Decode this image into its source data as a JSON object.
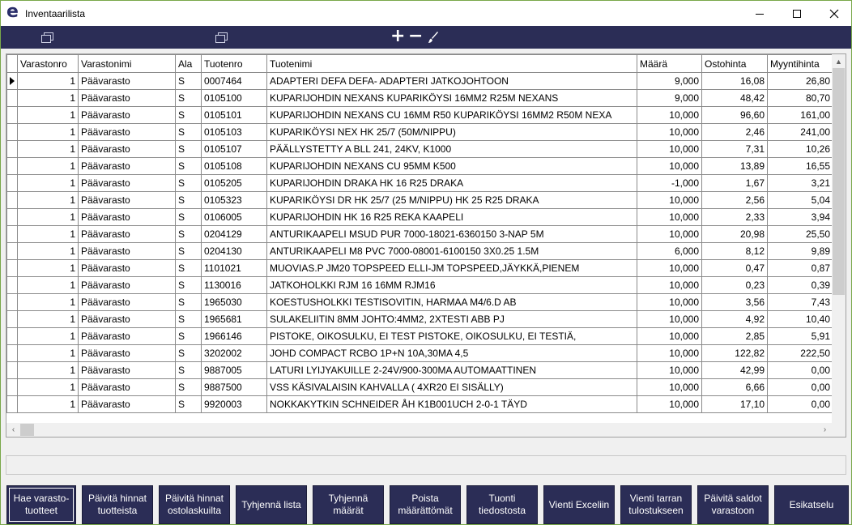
{
  "window": {
    "title": "Inventaarilista",
    "logo": "e"
  },
  "toolbar": {
    "icons": [
      "window-stack-icon",
      "window-stack-icon",
      "plus-icon",
      "minus-icon",
      "brush-icon"
    ],
    "plus": "+",
    "minus": "−"
  },
  "columns": [
    "Varastonro",
    "Varastonimi",
    "Ala",
    "Tuotenro",
    "Tuotenimi",
    "Määrä",
    "Ostohinta",
    "Myyntihinta"
  ],
  "rows": [
    {
      "varastonro": "1",
      "varastonimi": "Päävarasto",
      "ala": "S",
      "tuotenro": "0007464",
      "tuotenimi": "ADAPTERI DEFA DEFA- ADAPTERI JATKOJOHTOON",
      "maara": "9,000",
      "ostohinta": "16,08",
      "myyntihinta": "26,80"
    },
    {
      "varastonro": "1",
      "varastonimi": "Päävarasto",
      "ala": "S",
      "tuotenro": "0105100",
      "tuotenimi": "KUPARIJOHDIN NEXANS KUPARIKÖYSI 16MM2 R25M NEXANS",
      "maara": "9,000",
      "ostohinta": "48,42",
      "myyntihinta": "80,70"
    },
    {
      "varastonro": "1",
      "varastonimi": "Päävarasto",
      "ala": "S",
      "tuotenro": "0105101",
      "tuotenimi": "KUPARIJOHDIN NEXANS CU 16MM R50 KUPARIKÖYSI 16MM2 R50M NEXA",
      "maara": "10,000",
      "ostohinta": "96,60",
      "myyntihinta": "161,00"
    },
    {
      "varastonro": "1",
      "varastonimi": "Päävarasto",
      "ala": "S",
      "tuotenro": "0105103",
      "tuotenimi": "KUPARIKÖYSI NEX HK 25/7 (50M/NIPPU)",
      "maara": "10,000",
      "ostohinta": "2,46",
      "myyntihinta": "241,00"
    },
    {
      "varastonro": "1",
      "varastonimi": "Päävarasto",
      "ala": "S",
      "tuotenro": "0105107",
      "tuotenimi": "PÄÄLLYSTETTY A BLL 241, 24KV, K1000",
      "maara": "10,000",
      "ostohinta": "7,31",
      "myyntihinta": "10,26"
    },
    {
      "varastonro": "1",
      "varastonimi": "Päävarasto",
      "ala": "S",
      "tuotenro": "0105108",
      "tuotenimi": "KUPARIJOHDIN NEXANS CU 95MM K500",
      "maara": "10,000",
      "ostohinta": "13,89",
      "myyntihinta": "16,55"
    },
    {
      "varastonro": "1",
      "varastonimi": "Päävarasto",
      "ala": "S",
      "tuotenro": "0105205",
      "tuotenimi": "KUPARIJOHDIN DRAKA HK 16 R25 DRAKA",
      "maara": "-1,000",
      "ostohinta": "1,67",
      "myyntihinta": "3,21"
    },
    {
      "varastonro": "1",
      "varastonimi": "Päävarasto",
      "ala": "S",
      "tuotenro": "0105323",
      "tuotenimi": "KUPARIKÖYSI DR HK 25/7 (25 M/NIPPU) HK 25 R25 DRAKA",
      "maara": "10,000",
      "ostohinta": "2,56",
      "myyntihinta": "5,04"
    },
    {
      "varastonro": "1",
      "varastonimi": "Päävarasto",
      "ala": "S",
      "tuotenro": "0106005",
      "tuotenimi": "KUPARIJOHDIN HK 16 R25 REKA KAAPELI",
      "maara": "10,000",
      "ostohinta": "2,33",
      "myyntihinta": "3,94"
    },
    {
      "varastonro": "1",
      "varastonimi": "Päävarasto",
      "ala": "S",
      "tuotenro": "0204129",
      "tuotenimi": "ANTURIKAAPELI MSUD PUR 7000-18021-6360150 3-NAP 5M",
      "maara": "10,000",
      "ostohinta": "20,98",
      "myyntihinta": "25,50"
    },
    {
      "varastonro": "1",
      "varastonimi": "Päävarasto",
      "ala": "S",
      "tuotenro": "0204130",
      "tuotenimi": "ANTURIKAAPELI M8 PVC 7000-08001-6100150 3X0.25 1.5M",
      "maara": "6,000",
      "ostohinta": "8,12",
      "myyntihinta": "9,89"
    },
    {
      "varastonro": "1",
      "varastonimi": "Päävarasto",
      "ala": "S",
      "tuotenro": "1101021",
      "tuotenimi": "MUOVIAS.P JM20 TOPSPEED ELLI-JM TOPSPEED,JÄYKKÄ,PIENEM",
      "maara": "10,000",
      "ostohinta": "0,47",
      "myyntihinta": "0,87"
    },
    {
      "varastonro": "1",
      "varastonimi": "Päävarasto",
      "ala": "S",
      "tuotenro": "1130016",
      "tuotenimi": "JATKOHOLKKI RJM 16 16MM RJM16",
      "maara": "10,000",
      "ostohinta": "0,23",
      "myyntihinta": "0,39"
    },
    {
      "varastonro": "1",
      "varastonimi": "Päävarasto",
      "ala": "S",
      "tuotenro": "1965030",
      "tuotenimi": "KOESTUSHOLKKI TESTISOVITIN, HARMAA M4/6.D AB",
      "maara": "10,000",
      "ostohinta": "3,56",
      "myyntihinta": "7,43"
    },
    {
      "varastonro": "1",
      "varastonimi": "Päävarasto",
      "ala": "S",
      "tuotenro": "1965681",
      "tuotenimi": "SULAKELIITIN 8MM JOHTO:4MM2, 2XTESTI ABB PJ",
      "maara": "10,000",
      "ostohinta": "4,92",
      "myyntihinta": "10,40"
    },
    {
      "varastonro": "1",
      "varastonimi": "Päävarasto",
      "ala": "S",
      "tuotenro": "1966146",
      "tuotenimi": "PISTOKE, OIKOSULKU, EI TEST PISTOKE, OIKOSULKU, EI TESTIÄ,",
      "maara": "10,000",
      "ostohinta": "2,85",
      "myyntihinta": "5,91"
    },
    {
      "varastonro": "1",
      "varastonimi": "Päävarasto",
      "ala": "S",
      "tuotenro": "3202002",
      "tuotenimi": "JOHD COMPACT RCBO 1P+N 10A,30MA 4,5",
      "maara": "10,000",
      "ostohinta": "122,82",
      "myyntihinta": "222,50"
    },
    {
      "varastonro": "1",
      "varastonimi": "Päävarasto",
      "ala": "S",
      "tuotenro": "9887005",
      "tuotenimi": "LATURI LYIJYAKUILLE 2-24V/900-300MA AUTOMAATTINEN",
      "maara": "10,000",
      "ostohinta": "42,99",
      "myyntihinta": "0,00"
    },
    {
      "varastonro": "1",
      "varastonimi": "Päävarasto",
      "ala": "S",
      "tuotenro": "9887500",
      "tuotenimi": "VSS KÄSIVALAISIN KAHVALLA ( 4XR20 EI SISÄLLY)",
      "maara": "10,000",
      "ostohinta": "6,66",
      "myyntihinta": "0,00"
    },
    {
      "varastonro": "1",
      "varastonimi": "Päävarasto",
      "ala": "S",
      "tuotenro": "9920003",
      "tuotenimi": "NOKKAKYTKIN SCHNEIDER      ÅH K1B001UCH 2-0-1 TÄYD",
      "maara": "10,000",
      "ostohinta": "17,10",
      "myyntihinta": "0,00"
    }
  ],
  "buttons": [
    {
      "name": "hae-varastotuotteet-button",
      "label": "Hae varasto-\ntuotteet"
    },
    {
      "name": "paivita-hinnat-tuotteista-button",
      "label": "Päivitä hinnat\ntuotteista"
    },
    {
      "name": "paivita-hinnat-ostolaskuilta-button",
      "label": "Päivitä hinnat\nostolaskuilta"
    },
    {
      "name": "tyhjenna-lista-button",
      "label": "Tyhjennä lista"
    },
    {
      "name": "tyhjenna-maarat-button",
      "label": "Tyhjennä\nmäärät"
    },
    {
      "name": "poista-maarattomat-button",
      "label": "Poista\nmäärättömät"
    },
    {
      "name": "tuonti-tiedostosta-button",
      "label": "Tuonti\ntiedostosta"
    },
    {
      "name": "vienti-exceliin-button",
      "label": "Vienti Exceliin"
    },
    {
      "name": "vienti-tarran-tulostukseen-button",
      "label": "Vienti tarran\ntulostukseen"
    },
    {
      "name": "paivita-saldot-varastoon-button",
      "label": "Päivitä saldot\nvarastoon"
    },
    {
      "name": "esikatselu-button",
      "label": "Esikatselu"
    }
  ],
  "colors": {
    "toolbar": "#2b2d56",
    "button": "#2b2d56",
    "window_border": "#79a84a"
  }
}
